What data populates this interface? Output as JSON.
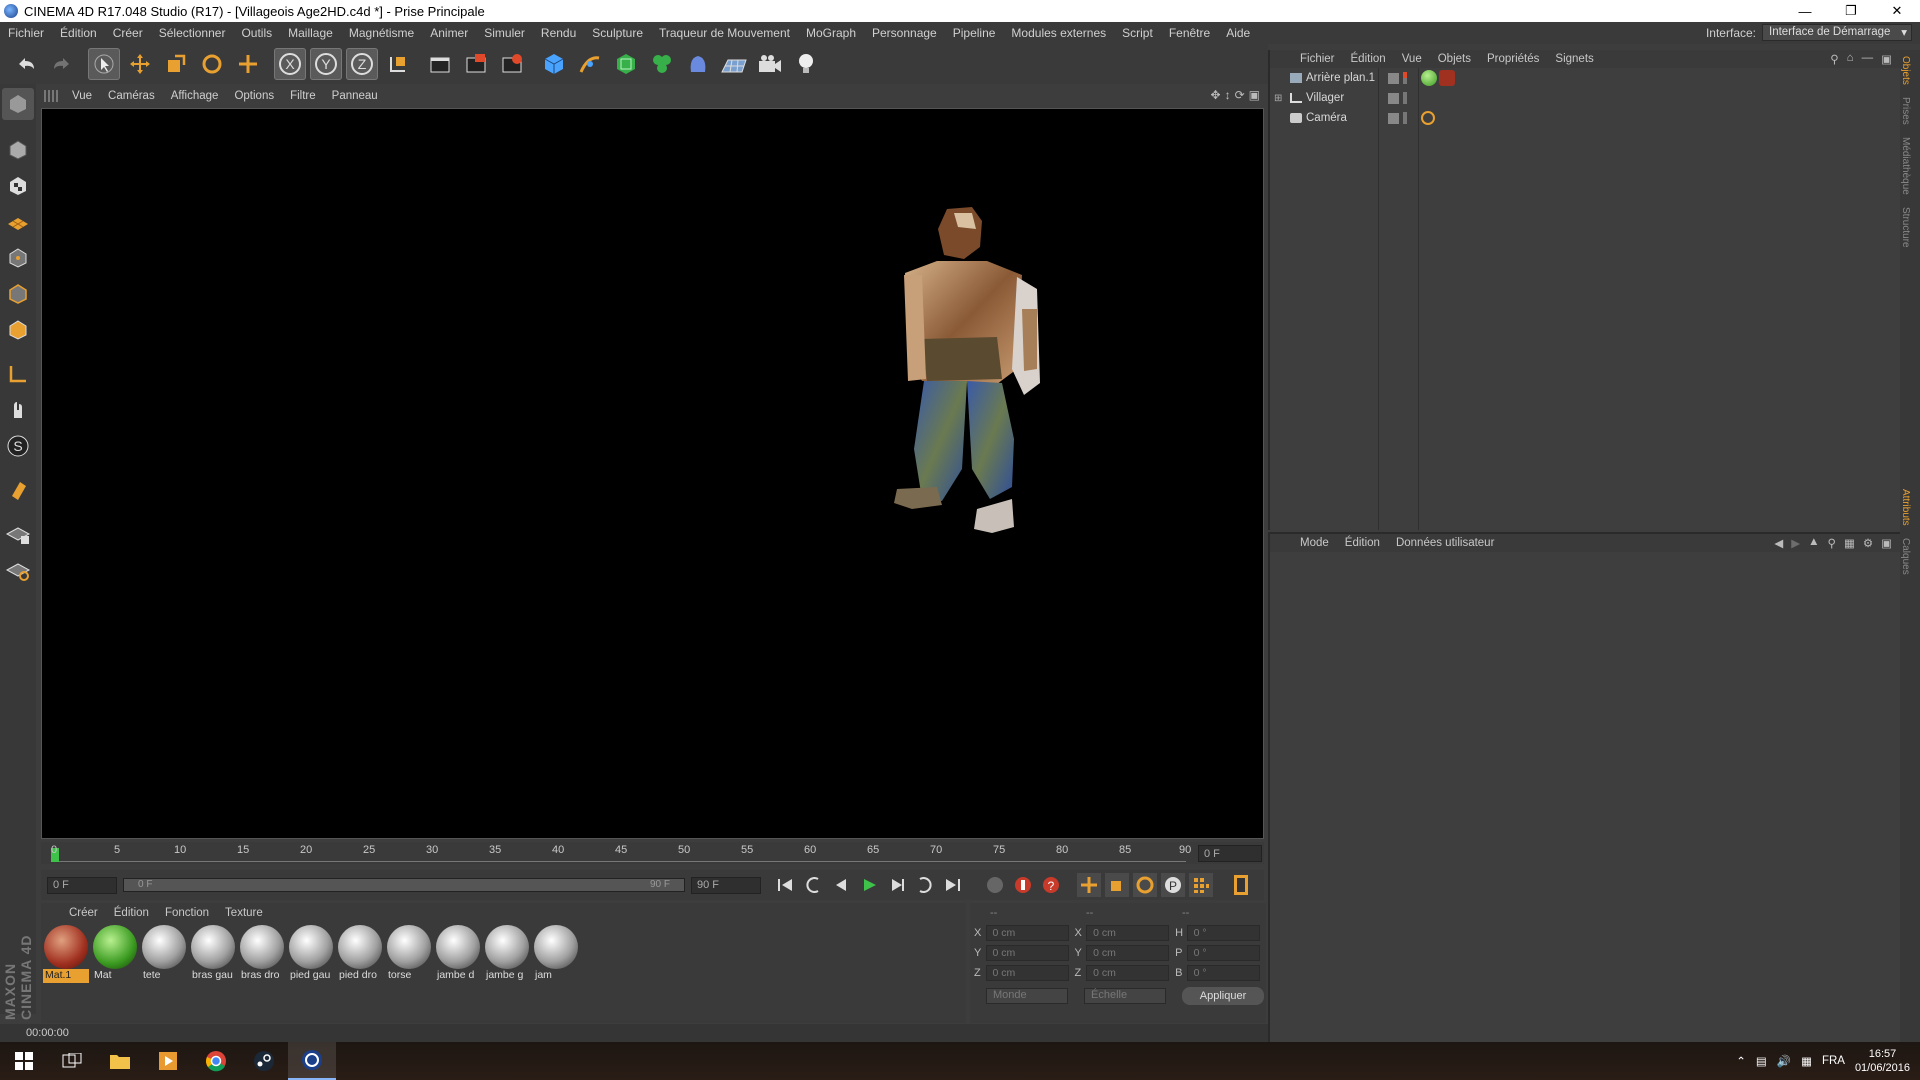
{
  "window": {
    "title": "CINEMA 4D R17.048 Studio (R17) - [Villageois Age2HD.c4d *] - Prise Principale",
    "controls": [
      "minimize-icon",
      "maximize-icon",
      "close-icon"
    ]
  },
  "menubar": {
    "items": [
      "Fichier",
      "Édition",
      "Créer",
      "Sélectionner",
      "Outils",
      "Maillage",
      "Magnétisme",
      "Animer",
      "Simuler",
      "Rendu",
      "Sculpture",
      "Traqueur de Mouvement",
      "MoGraph",
      "Personnage",
      "Pipeline",
      "Modules externes",
      "Script",
      "Fenêtre",
      "Aide"
    ],
    "interface_label": "Interface:",
    "interface_value": "Interface de Démarrage"
  },
  "viewport": {
    "menu": [
      "Vue",
      "Caméras",
      "Affichage",
      "Options",
      "Filtre",
      "Panneau"
    ]
  },
  "timeline": {
    "ticks": [
      "0",
      "5",
      "10",
      "15",
      "20",
      "25",
      "30",
      "35",
      "40",
      "45",
      "50",
      "55",
      "60",
      "65",
      "70",
      "75",
      "80",
      "85",
      "90"
    ],
    "current_frame": "0 F"
  },
  "transport": {
    "start_field": "0 F",
    "range_start": "0 F",
    "range_end": "90 F",
    "end_field": "90 F"
  },
  "materials": {
    "menu": [
      "Créer",
      "Édition",
      "Fonction",
      "Texture"
    ],
    "items": [
      {
        "label": "Mat.1",
        "kind": "red",
        "selected": true
      },
      {
        "label": "Mat",
        "kind": "green",
        "selected": false
      },
      {
        "label": "tete",
        "kind": "grey",
        "selected": false
      },
      {
        "label": "bras gau",
        "kind": "grey",
        "selected": false
      },
      {
        "label": "bras dro",
        "kind": "grey",
        "selected": false
      },
      {
        "label": "pied gau",
        "kind": "grey",
        "selected": false
      },
      {
        "label": "pied dro",
        "kind": "grey",
        "selected": false
      },
      {
        "label": "torse",
        "kind": "grey",
        "selected": false
      },
      {
        "label": "jambe d",
        "kind": "grey",
        "selected": false
      },
      {
        "label": "jambe g",
        "kind": "grey",
        "selected": false
      },
      {
        "label": "jam",
        "kind": "grey",
        "selected": false
      }
    ],
    "logo_text": "MAXON CINEMA 4D"
  },
  "coords": {
    "headers": [
      "--",
      "--",
      "--"
    ],
    "rows": [
      {
        "a": "X",
        "v1": "0 cm",
        "b": "X",
        "v2": "0 cm",
        "c": "H",
        "v3": "0 °"
      },
      {
        "a": "Y",
        "v1": "0 cm",
        "b": "Y",
        "v2": "0 cm",
        "c": "P",
        "v3": "0 °"
      },
      {
        "a": "Z",
        "v1": "0 cm",
        "b": "Z",
        "v2": "0 cm",
        "c": "B",
        "v3": "0 °"
      }
    ],
    "mode1": "Monde",
    "mode2": "Échelle",
    "apply": "Appliquer"
  },
  "status": {
    "time": "00:00:00"
  },
  "objects": {
    "menu": [
      "Fichier",
      "Édition",
      "Vue",
      "Objets",
      "Propriétés",
      "Signets"
    ],
    "items": [
      {
        "name": "Arrière plan.1",
        "icon": "background-icon"
      },
      {
        "name": "Villager",
        "icon": "null-object-icon"
      },
      {
        "name": "Caméra",
        "icon": "camera-icon"
      }
    ]
  },
  "attributes": {
    "menu": [
      "Mode",
      "Édition",
      "Données utilisateur"
    ]
  },
  "sidetabs": {
    "top": [
      "Objets",
      "Prises",
      "Médiathèque",
      "Structure"
    ],
    "bottom": [
      "Attributs",
      "Calques"
    ]
  },
  "taskbar": {
    "lang": "FRA",
    "time": "16:57",
    "date": "01/06/2016"
  },
  "colors": {
    "ui_bg": "#3d3d3d",
    "viewport_bg": "#000000",
    "accent_blue": "#4aa3ff",
    "play_green": "#3fc24a"
  }
}
